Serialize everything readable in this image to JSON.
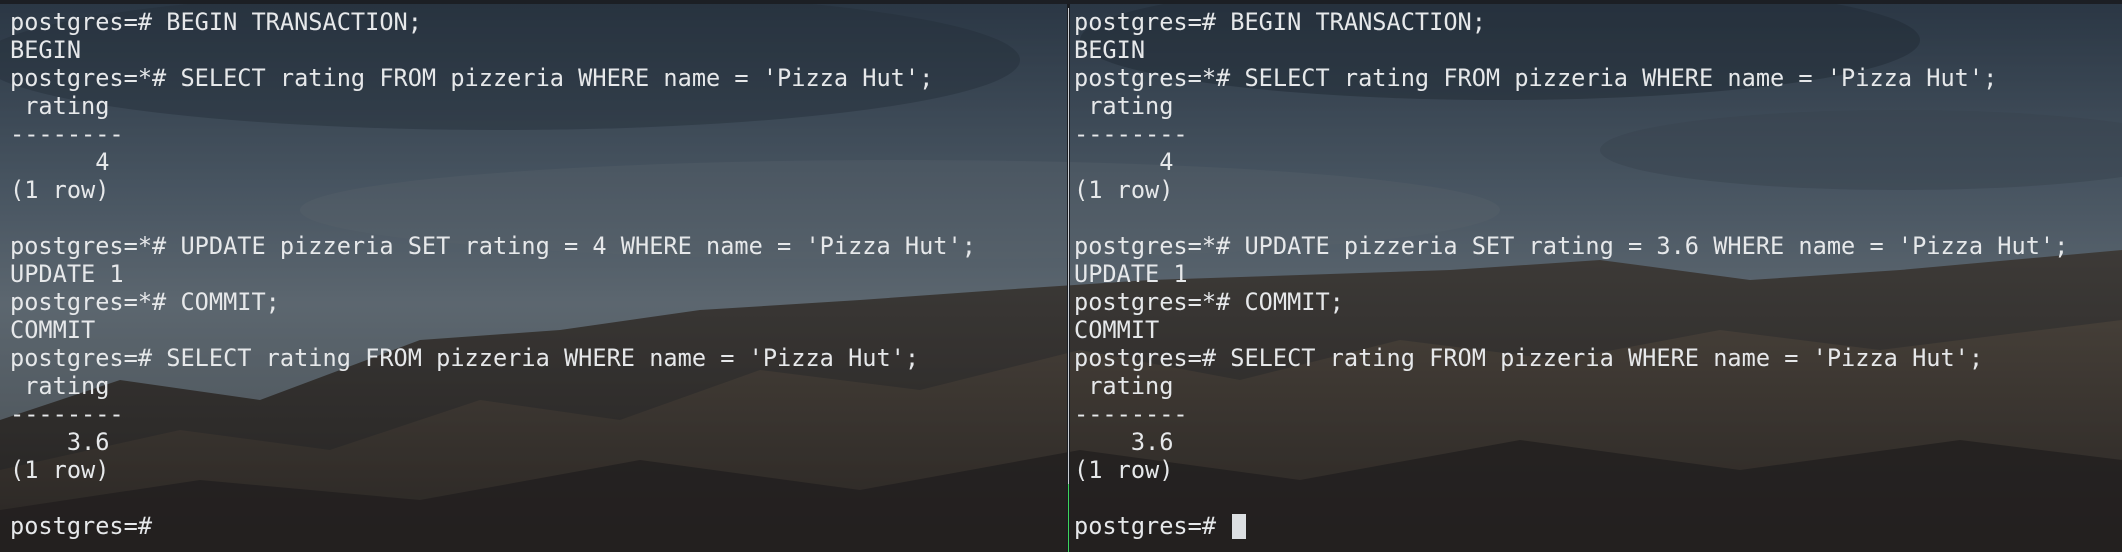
{
  "left_pane": {
    "lines": [
      "postgres=# BEGIN TRANSACTION;",
      "BEGIN",
      "postgres=*# SELECT rating FROM pizzeria WHERE name = 'Pizza Hut';",
      " rating",
      "--------",
      "      4",
      "(1 row)",
      "",
      "postgres=*# UPDATE pizzeria SET rating = 4 WHERE name = 'Pizza Hut';",
      "UPDATE 1",
      "postgres=*# COMMIT;",
      "COMMIT",
      "postgres=# SELECT rating FROM pizzeria WHERE name = 'Pizza Hut';",
      " rating",
      "--------",
      "    3.6",
      "(1 row)",
      "",
      "postgres=#"
    ]
  },
  "right_pane": {
    "lines": [
      "postgres=# BEGIN TRANSACTION;",
      "BEGIN",
      "postgres=*# SELECT rating FROM pizzeria WHERE name = 'Pizza Hut';",
      " rating",
      "--------",
      "      4",
      "(1 row)",
      "",
      "postgres=*# UPDATE pizzeria SET rating = 3.6 WHERE name = 'Pizza Hut';",
      "UPDATE 1",
      "postgres=*# COMMIT;",
      "COMMIT",
      "postgres=# SELECT rating FROM pizzeria WHERE name = 'Pizza Hut';",
      " rating",
      "--------",
      "    3.6",
      "(1 row)",
      "",
      "postgres=# "
    ],
    "active": true
  },
  "colors": {
    "text": "#e6e8ea",
    "active_border": "#3fd65a",
    "cursor": "#dcdfe2"
  }
}
